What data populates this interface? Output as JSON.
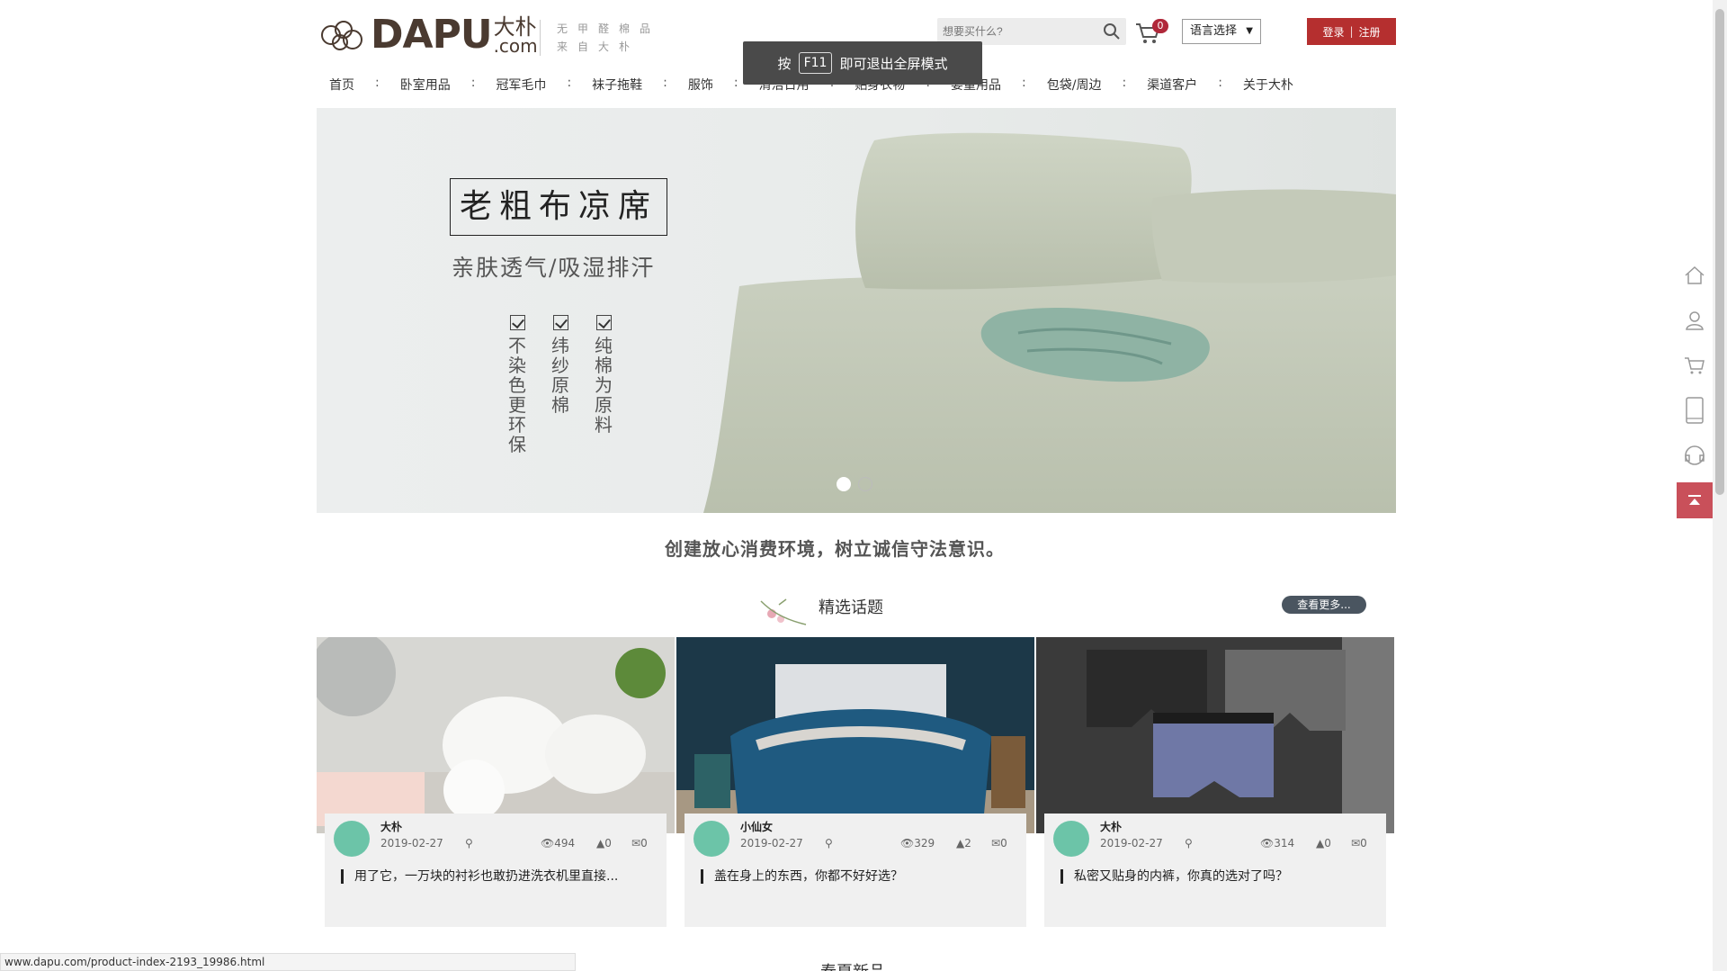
{
  "header": {
    "logo_text": "DAPU",
    "logo_cn": "大朴",
    "logo_com": ".com",
    "slogan_line1": "无甲醛棉品",
    "slogan_line2": "来自大朴",
    "search_placeholder": "想要买什么?",
    "cart_count": "0",
    "language_label": "语言选择",
    "login_label": "登录",
    "register_label": "注册",
    "auth_separator": "|"
  },
  "toast": {
    "prefix": "按",
    "key": "F11",
    "suffix": "即可退出全屏模式"
  },
  "nav": {
    "items": [
      "首页",
      "卧室用品",
      "冠军毛巾",
      "袜子拖鞋",
      "服饰",
      "清洁日用",
      "贴身衣物",
      "婴童用品",
      "包袋/周边",
      "渠道客户",
      "关于大朴"
    ],
    "separator": ":"
  },
  "banner": {
    "title": "老粗布凉席",
    "subtitle": "亲肤透气/吸湿排汗",
    "features": [
      "不染色更环保",
      "纬纱原棉",
      "纯棉为原料"
    ],
    "slides": 2,
    "active_slide": 1
  },
  "motto": "创建放心消费环境，树立诚信守法意识。",
  "topics": {
    "title": "精选话题",
    "more_label": "查看更多...",
    "cards": [
      {
        "author": "大朴",
        "date": "2019-02-27",
        "views": "494",
        "likes": "0",
        "comments": "0",
        "title": "用了它，一万块的衬衫也敢扔进洗衣机里直接..."
      },
      {
        "author": "小仙女",
        "date": "2019-02-27",
        "views": "329",
        "likes": "2",
        "comments": "0",
        "title": "盖在身上的东西，你都不好好选？"
      },
      {
        "author": "大朴",
        "date": "2019-02-27",
        "views": "314",
        "likes": "0",
        "comments": "0",
        "title": "私密又贴身的内裤，你真的选对了吗？"
      }
    ]
  },
  "next_section_title": "春夏新品",
  "status_url": "www.dapu.com/product-index-2193_19986.html",
  "colors": {
    "brand_red": "#b52f2f",
    "logo_brown": "#4a3a30",
    "avatar_green": "#6cc4a8",
    "back_to_top": "#c9505a"
  },
  "icons": [
    "search-icon",
    "cart-icon",
    "home-icon",
    "user-icon",
    "side-cart-icon",
    "app-icon",
    "service-icon",
    "back-to-top-icon",
    "location-icon",
    "eye-icon",
    "thumb-icon",
    "comment-icon"
  ]
}
